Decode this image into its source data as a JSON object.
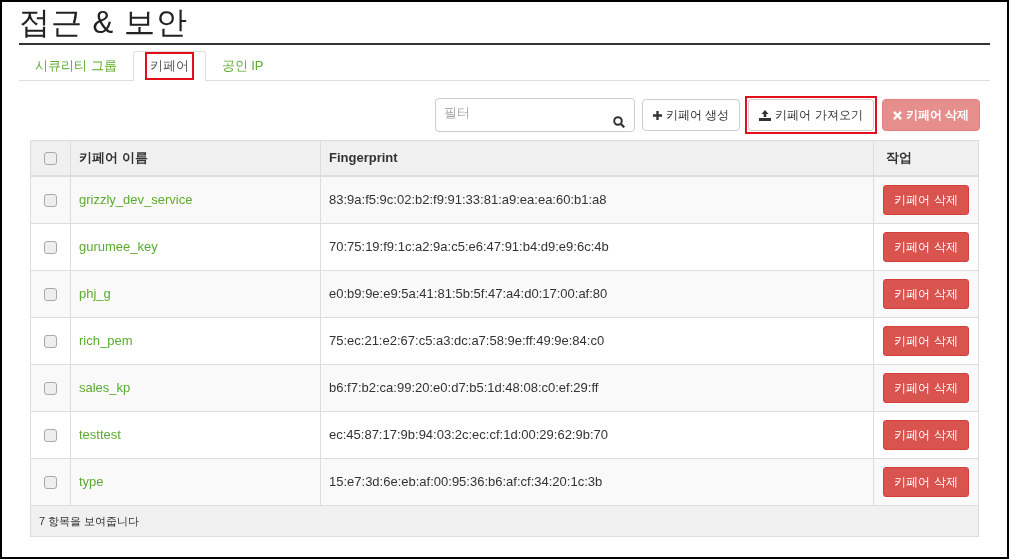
{
  "page": {
    "title": "접근 & 보안"
  },
  "tabs": [
    {
      "label": "시큐리티 그룹",
      "selected": false,
      "highlighted": false
    },
    {
      "label": "키페어",
      "selected": true,
      "highlighted": true
    },
    {
      "label": "공인 IP",
      "selected": false,
      "highlighted": false
    }
  ],
  "filter": {
    "placeholder": "필터"
  },
  "toolbar": [
    {
      "kind": "create",
      "label": "키페어 생성",
      "disabled": false,
      "highlighted": false
    },
    {
      "kind": "import",
      "label": "키페어 가져오기",
      "disabled": false,
      "highlighted": true
    },
    {
      "kind": "delete",
      "label": "키페어 삭제",
      "disabled": true,
      "highlighted": false
    }
  ],
  "table": {
    "columns": [
      "키페어 이름",
      "Fingerprint",
      "작업"
    ],
    "header_checked": false,
    "rows": [
      {
        "name": "grizzly_dev_service",
        "fingerprint": "83:9a:f5:9c:02:b2:f9:91:33:81:a9:ea:ea:60:b1:a8",
        "action": "키페어 삭제",
        "checked": false
      },
      {
        "name": "gurumee_key",
        "fingerprint": "70:75:19:f9:1c:a2:9a:c5:e6:47:91:b4:d9:e9:6c:4b",
        "action": "키페어 삭제",
        "checked": false
      },
      {
        "name": "phj_g",
        "fingerprint": "e0:b9:9e:e9:5a:41:81:5b:5f:47:a4:d0:17:00:af:80",
        "action": "키페어 삭제",
        "checked": false
      },
      {
        "name": "rich_pem",
        "fingerprint": "75:ec:21:e2:67:c5:a3:dc:a7:58:9e:ff:49:9e:84:c0",
        "action": "키페어 삭제",
        "checked": false
      },
      {
        "name": "sales_kp",
        "fingerprint": "b6:f7:b2:ca:99:20:e0:d7:b5:1d:48:08:c0:ef:29:ff",
        "action": "키페어 삭제",
        "checked": false
      },
      {
        "name": "testtest",
        "fingerprint": "ec:45:87:17:9b:94:03:2c:ec:cf:1d:00:29:62:9b:70",
        "action": "키페어 삭제",
        "checked": false
      },
      {
        "name": "type",
        "fingerprint": "15:e7:3d:6e:eb:af:00:95:36:b6:af:cf:34:20:1c:3b",
        "action": "키페어 삭제",
        "checked": false
      }
    ],
    "footer": "7 항목을 보여줍니다"
  }
}
